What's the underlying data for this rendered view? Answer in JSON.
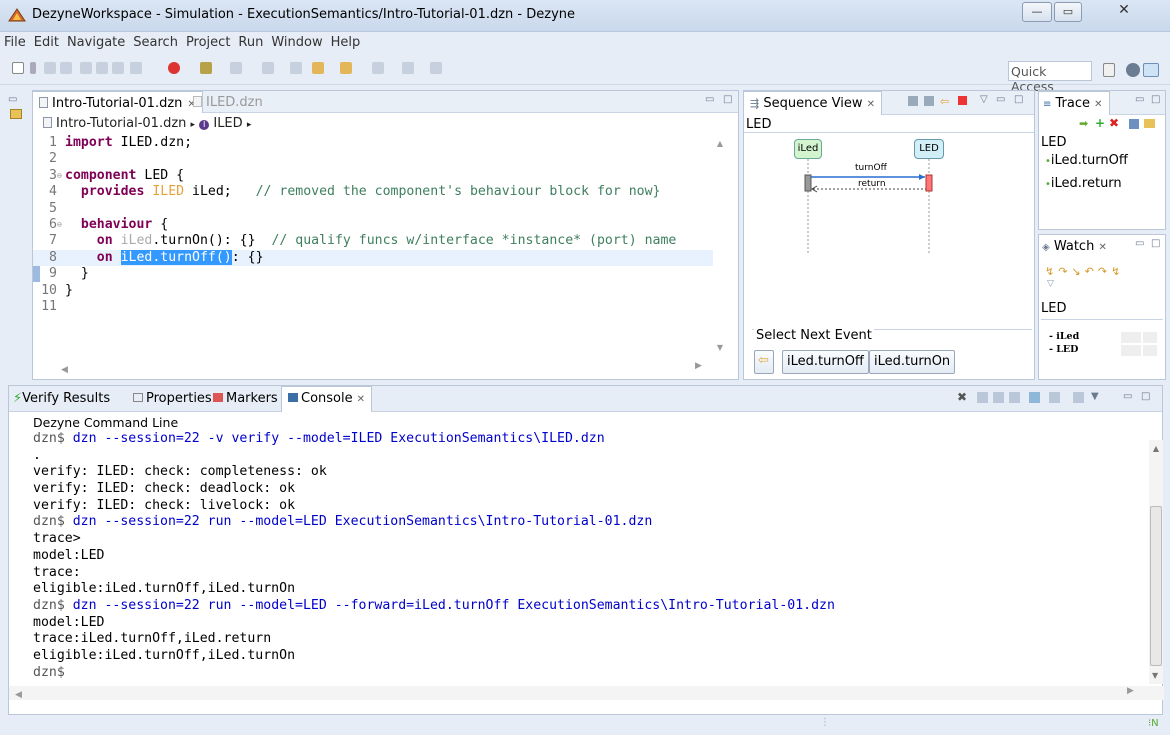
{
  "window": {
    "title": "DezyneWorkspace - Simulation - ExecutionSemantics/Intro-Tutorial-01.dzn - Dezyne"
  },
  "menu": [
    "File",
    "Edit",
    "Navigate",
    "Search",
    "Project",
    "Run",
    "Window",
    "Help"
  ],
  "toolbar": {
    "quick_access": "Quick Access"
  },
  "editor": {
    "tabs": [
      {
        "label": "Intro-Tutorial-01.dzn",
        "active": true
      },
      {
        "label": "ILED.dzn",
        "active": false
      }
    ],
    "breadcrumb": {
      "file": "Intro-Tutorial-01.dzn",
      "sep": "▸",
      "item": "ILED",
      "arrow": "▸"
    },
    "lines": [
      {
        "n": "1",
        "parts": [
          {
            "t": "import",
            "c": "kw"
          },
          {
            "t": " ILED.dzn;",
            "c": ""
          }
        ]
      },
      {
        "n": "2",
        "parts": []
      },
      {
        "n": "3",
        "parts": [
          {
            "t": "component",
            "c": "kw"
          },
          {
            "t": " LED {",
            "c": ""
          }
        ]
      },
      {
        "n": "4",
        "parts": [
          {
            "t": "  provides",
            "c": "kw"
          },
          {
            "t": " ILED",
            "c": "ty"
          },
          {
            "t": " iLed;   ",
            "c": ""
          },
          {
            "t": "// removed the component's behaviour block for now}",
            "c": "cm"
          }
        ]
      },
      {
        "n": "5",
        "parts": []
      },
      {
        "n": "6",
        "parts": [
          {
            "t": "  behaviour",
            "c": "kw"
          },
          {
            "t": " {",
            "c": ""
          }
        ]
      },
      {
        "n": "7",
        "parts": [
          {
            "t": "    on",
            "c": "kw"
          },
          {
            "t": " iLed",
            "c": "gr"
          },
          {
            "t": ".turnOn(): {}  ",
            "c": ""
          },
          {
            "t": "// qualify funcs w/interface *instance* (port) name",
            "c": "cm"
          }
        ]
      },
      {
        "n": "8",
        "parts": [
          {
            "t": "    on",
            "c": "kw"
          },
          {
            "t": " ",
            "c": ""
          },
          {
            "t": "iLed.turnOff()",
            "c": "sel"
          },
          {
            "t": ": {}",
            "c": ""
          }
        ]
      },
      {
        "n": "9",
        "parts": [
          {
            "t": "  }",
            "c": ""
          }
        ]
      },
      {
        "n": "10",
        "parts": [
          {
            "t": "}",
            "c": ""
          }
        ]
      },
      {
        "n": "11",
        "parts": []
      }
    ]
  },
  "sequence_view": {
    "tab": "Sequence View",
    "component": "LED",
    "lifelines": [
      "iLed",
      "LED"
    ],
    "messages": [
      {
        "label": "turnOff"
      },
      {
        "label": "return"
      }
    ],
    "select_next_event": "Select Next Event",
    "event_buttons": [
      "iLed.turnOff",
      "iLed.turnOn"
    ]
  },
  "trace": {
    "tab": "Trace",
    "component": "LED",
    "items": [
      "iLed.turnOff",
      "iLed.return"
    ]
  },
  "watch": {
    "tab": "Watch",
    "component": "LED",
    "rows": [
      "- iLed",
      "- LED"
    ]
  },
  "console": {
    "tabs": [
      "Verify Results",
      "Properties",
      "Markers",
      "Console"
    ],
    "header": "Dezyne Command Line",
    "lines": [
      {
        "t": "dzn$ ",
        "cmd": "dzn --session=22 -v verify --model=ILED ExecutionSemantics\\ILED.dzn"
      },
      {
        "t": "."
      },
      {
        "t": "verify: ILED: check: completeness: ok"
      },
      {
        "t": "verify: ILED: check: deadlock: ok"
      },
      {
        "t": "verify: ILED: check: livelock: ok"
      },
      {
        "t": "dzn$ ",
        "cmd": "dzn --session=22 run --model=LED ExecutionSemantics\\Intro-Tutorial-01.dzn"
      },
      {
        "t": "trace>"
      },
      {
        "t": "model:LED"
      },
      {
        "t": "trace:"
      },
      {
        "t": "eligible:iLed.turnOff,iLed.turnOn"
      },
      {
        "t": "dzn$ ",
        "cmd": "dzn --session=22 run --model=LED --forward=iLed.turnOff ExecutionSemantics\\Intro-Tutorial-01.dzn"
      },
      {
        "t": "model:LED"
      },
      {
        "t": "trace:iLed.turnOff,iLed.return"
      },
      {
        "t": "eligible:iLed.turnOff,iLed.turnOn"
      },
      {
        "t": "dzn$"
      }
    ]
  },
  "colors": {
    "keyword": "#7f0055",
    "type": "#e9a23a",
    "comment": "#3f7f5f",
    "selection": "#3399ff",
    "command": "#0000cc"
  }
}
